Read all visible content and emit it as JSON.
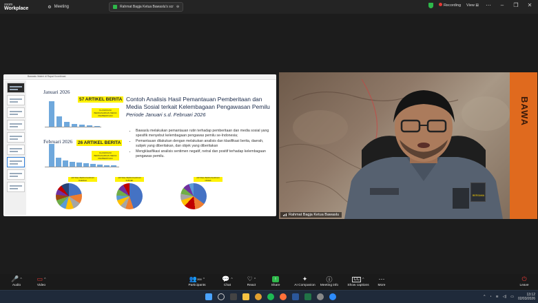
{
  "app": {
    "logo_line1": "zoom",
    "logo_line2": "Workplace",
    "meeting_menu": "Meeting",
    "share_tab_title": "Rahmat Bagja Ketua Bawaslu's scr",
    "recording_label": "Recording",
    "view_label": "View"
  },
  "slide": {
    "toolbar_text": "Bawaslu Materi di Rapat Koordinasi",
    "jan_label": "Januari 2026",
    "jan_count": "57 ARTIKEL BERITA",
    "jan_tag": "KLASIFIKASI BERDASARKAN MEDIA PEMBERITAAN",
    "feb_label": "Februari 2026",
    "feb_count": "26 ARTIKEL BERITA",
    "feb_tag": "KLASIFIKASI BERDASARKAN MEDIA PEMBERITAAN",
    "title": "Contoh Analisis Hasil Pemantauan Pemberitaan dan Media Sosial terkait Kelembagaan Pengawasan Pemilu",
    "subtitle": "Periode Januari  s.d. Februari 2026",
    "bullets": [
      "Bawaslu melakukan pemantauan rutin terhadap pemberitaan dan media sosial yang spesifik menyebut kelembagaan pengawas pemilu se-Indonesia;",
      "Pemantauan dilakukan dengan melakukan analisis dan klasifikasi berita, daerah, subjek yang diberitakan, dan objek yang diberitakan",
      "Mengklasifikasi analisis sentimen negatif, netral dan positif terhadap kelembagaan pengawas pemilu."
    ],
    "pie_tags": [
      "ARTIKEL BERDASARKAN DAERAH",
      "ARTIKEL BERDASARKAN SUBJEK",
      "ARTIKEL BERDASARKAN OBJEK"
    ]
  },
  "video": {
    "name_tag": "Rahmat Bagja Ketua Bawaslu",
    "banner_text": "BAWA",
    "badge_text": "BERSAMA"
  },
  "toolbar": {
    "audio": "Audio",
    "video": "Video",
    "participants": "Participants",
    "participants_count": "200",
    "chat": "Chat",
    "react": "React",
    "share": "Share",
    "ai": "AI Companion",
    "info": "Meeting info",
    "captions": "Show captions",
    "more": "More",
    "leave": "Leave"
  },
  "taskbar": {
    "time": "13:12",
    "date": "02/03/2026"
  },
  "colors": {
    "accent_green": "#2eb84a",
    "highlight_yellow": "#fff200",
    "leave_red": "#e53935",
    "banner_orange": "#e06a1e"
  }
}
